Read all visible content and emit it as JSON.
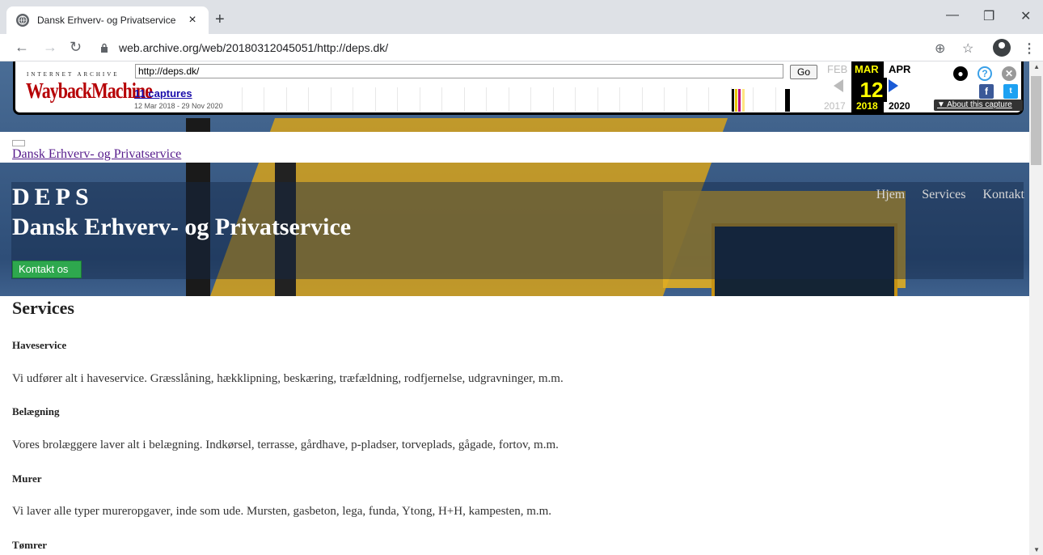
{
  "browser": {
    "tab_title": "Dansk Erhverv- og Privatservice",
    "tab_close": "×",
    "new_tab": "+",
    "url": "web.archive.org/web/20180312045051/http://deps.dk/",
    "back": "←",
    "forward": "→",
    "reload": "↻",
    "zoom_icon": "⊕",
    "star_icon": "☆",
    "menu_icon": "⋮",
    "min": "—",
    "max": "❐",
    "close": "✕"
  },
  "wayback": {
    "ia_text": "INTERNET ARCHIVE",
    "logo_text": "WaybackMachine",
    "url_value": "http://deps.dk/",
    "go_label": "Go",
    "captures": "11 captures",
    "range": "12 Mar 2018 - 29 Nov 2020",
    "prev_month": "FEB",
    "cur_month": "MAR",
    "next_month": "APR",
    "day": "12",
    "prev_year": "2017",
    "cur_year": "2018",
    "next_year": "2020",
    "about": "About this capture",
    "about_arrow": "▼"
  },
  "page": {
    "logo_alt": "Dansk Erhverv- og Privatservice",
    "brand": "DEPS",
    "brand_sub": "Dansk Erhverv- og Privatservice",
    "nav": [
      "Hjem",
      "Services",
      "Kontakt"
    ],
    "cta": "Kontakt os",
    "section_title": "Services",
    "services": [
      {
        "title": "Haveservice",
        "text": "Vi udfører alt i haveservice. Græsslåning, hækklipning, beskæring, træfældning, rodfjernelse, udgravninger, m.m."
      },
      {
        "title": "Belægning",
        "text": "Vores brolæggere laver alt i belægning. Indkørsel, terrasse, gårdhave, p-pladser, torveplads, gågade, fortov, m.m."
      },
      {
        "title": "Murer",
        "text": "Vi laver alle typer mureropgaver, inde som ude. Mursten, gasbeton, lega, funda, Ytong, H+H, kampesten, m.m."
      },
      {
        "title": "Tømrer",
        "text": ""
      }
    ]
  },
  "colors": {
    "accent_green": "#2ea84e",
    "wayback_red": "#b60005",
    "link_blue": "#1a0dab"
  }
}
